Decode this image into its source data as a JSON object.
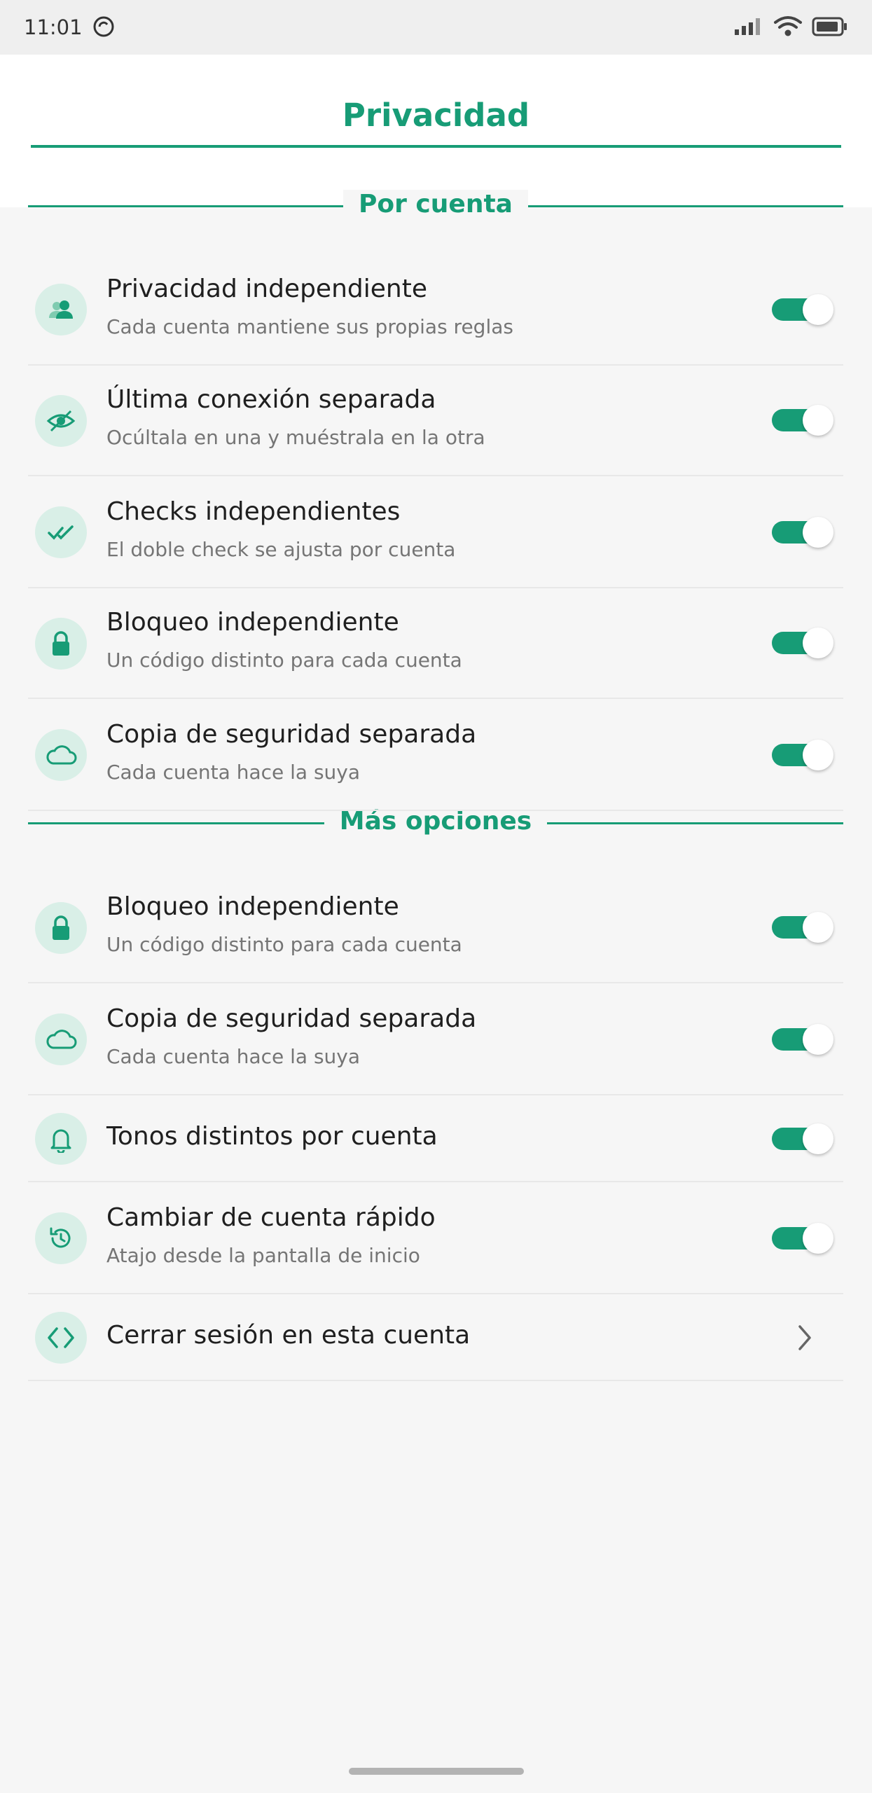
{
  "status": {
    "time": "11:01"
  },
  "header": {
    "title": "Privacidad"
  },
  "colors": {
    "accent": "#179c76",
    "icon_bg": "#d9efe7"
  },
  "sections": [
    {
      "label": "Por cuenta",
      "items": [
        {
          "title": "Privacidad independiente",
          "subtitle": "Cada cuenta mantiene sus propias reglas",
          "icon": "people-icon",
          "toggle_on": true
        },
        {
          "title": "Última conexión separada",
          "subtitle": "Ocúltala en una y muéstrala en la otra",
          "icon": "eye-off-icon",
          "toggle_on": true
        },
        {
          "title": "Checks independientes",
          "subtitle": "El doble check se ajusta por cuenta",
          "icon": "double-check-icon",
          "toggle_on": true
        },
        {
          "title": "Bloqueo independiente",
          "subtitle": "Un código distinto para cada cuenta",
          "icon": "lock-icon",
          "toggle_on": true
        },
        {
          "title": "Copia de seguridad separada",
          "subtitle": "Cada cuenta hace la suya",
          "icon": "cloud-icon",
          "toggle_on": true
        }
      ]
    },
    {
      "label": "Más opciones",
      "items": [
        {
          "title": "Bloqueo independiente",
          "subtitle": "Un código distinto para cada cuenta",
          "icon": "lock-icon",
          "toggle_on": true
        },
        {
          "title": "Copia de seguridad separada",
          "subtitle": "Cada cuenta hace la suya",
          "icon": "cloud-icon",
          "toggle_on": true
        },
        {
          "title": "Tonos distintos por cuenta",
          "subtitle": "",
          "icon": "bell-icon",
          "toggle_on": true
        },
        {
          "title": "Cambiar de cuenta rápido",
          "subtitle": "Atajo desde la pantalla de inicio",
          "icon": "history-icon",
          "toggle_on": true
        },
        {
          "title": "Cerrar sesión en esta cuenta",
          "subtitle": "",
          "icon": "code-icon",
          "chevron": true
        }
      ]
    }
  ]
}
